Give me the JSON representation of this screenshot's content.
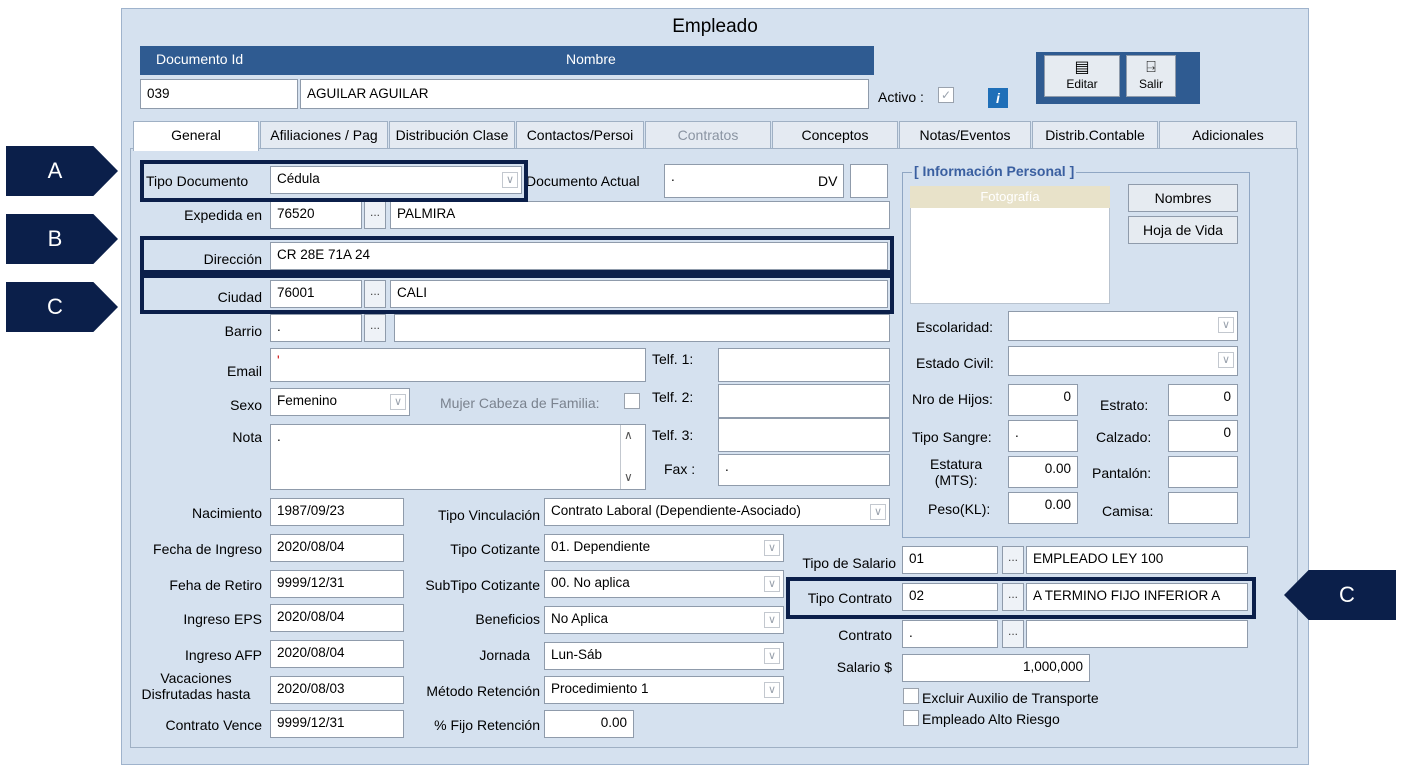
{
  "window": {
    "title": "Empleado"
  },
  "header": {
    "doc_id_label": "Documento Id",
    "name_label": "Nombre",
    "doc_id_value": "039",
    "name_value": "AGUILAR AGUILAR",
    "active_label": "Activo :",
    "info_icon": "i"
  },
  "toolbar": {
    "edit_label": "Editar",
    "exit_label": "Salir"
  },
  "tabs": [
    "General",
    "Afiliaciones / Pag",
    "Distribución Clase",
    "Contactos/Persoi",
    "Contratos",
    "Conceptos",
    "Notas/Eventos",
    "Distrib.Contable",
    "Adicionales"
  ],
  "form": {
    "tipo_documento_label": "Tipo Documento",
    "tipo_documento_value": "Cédula",
    "documento_actual_label": "Documento Actual",
    "documento_actual_value": ".",
    "dv_label": "DV",
    "dv_value": "",
    "expedida_label": "Expedida en",
    "expedida_code": "76520",
    "expedida_name": "PALMIRA",
    "direccion_label": "Dirección",
    "direccion_value": "CR 28E 71A 24",
    "ciudad_label": "Ciudad",
    "ciudad_code": "76001",
    "ciudad_name": "CALI",
    "barrio_label": "Barrio",
    "barrio_code": ".",
    "barrio_name": "",
    "email_label": "Email",
    "email_value": "'",
    "sexo_label": "Sexo",
    "sexo_value": "Femenino",
    "mujer_cabeza_label": "Mujer Cabeza de Familia:",
    "nota_label": "Nota",
    "nota_value": ".",
    "telf1_label": "Telf. 1:",
    "telf2_label": "Telf. 2:",
    "telf3_label": "Telf. 3:",
    "fax_label": "Fax :",
    "fax_value": ".",
    "nacimiento_label": "Nacimiento",
    "nacimiento_value": "1987/09/23",
    "fecha_ingreso_label": "Fecha de Ingreso",
    "fecha_ingreso_value": "2020/08/04",
    "fecha_retiro_label": "Feha de Retiro",
    "fecha_retiro_value": "9999/12/31",
    "ingreso_eps_label": "Ingreso EPS",
    "ingreso_eps_value": "2020/08/04",
    "ingreso_afp_label": "Ingreso AFP",
    "ingreso_afp_value": "2020/08/04",
    "vacaciones_label_1": "Vacaciones",
    "vacaciones_label_2": "Disfrutadas hasta",
    "vacaciones_value": "2020/08/03",
    "contrato_vence_label": "Contrato Vence",
    "contrato_vence_value": "9999/12/31",
    "tipo_vinculacion_label": "Tipo Vinculación",
    "tipo_vinculacion_value": "Contrato Laboral (Dependiente-Asociado)",
    "tipo_cotizante_label": "Tipo Cotizante",
    "tipo_cotizante_value": "01. Dependiente",
    "subtipo_cotizante_label": "SubTipo Cotizante",
    "subtipo_cotizante_value": "00. No aplica",
    "beneficios_label": "Beneficios",
    "beneficios_value": "No Aplica",
    "jornada_label": "Jornada",
    "jornada_value": "Lun-Sáb",
    "metodo_retencion_label": "Método Retención",
    "metodo_retencion_value": "Procedimiento 1",
    "fijo_retencion_label": "% Fijo Retención",
    "fijo_retencion_value": "0.00",
    "tipo_salario_label": "Tipo de Salario",
    "tipo_salario_code": "01",
    "tipo_salario_name": "EMPLEADO LEY 100",
    "tipo_contrato_label": "Tipo Contrato",
    "tipo_contrato_code": "02",
    "tipo_contrato_name": "A TERMINO FIJO  INFERIOR A",
    "contrato_label": "Contrato",
    "contrato_code": ".",
    "salario_label": "Salario $",
    "salario_value": "1,000,000",
    "excluir_auxilio_label": "Excluir Auxilio de Transporte",
    "alto_riesgo_label": "Empleado Alto Riesgo"
  },
  "personal": {
    "title": "[ Información Personal ]",
    "foto_label": "Fotografía",
    "nombres_button": "Nombres",
    "hoja_vida_button": "Hoja de Vida",
    "escolaridad_label": "Escolaridad:",
    "estado_civil_label": "Estado Civil:",
    "nro_hijos_label": "Nro de Hijos:",
    "nro_hijos_value": "0",
    "estrato_label": "Estrato:",
    "estrato_value": "0",
    "tipo_sangre_label": "Tipo Sangre:",
    "tipo_sangre_value": ".",
    "calzado_label": "Calzado:",
    "calzado_value": "0",
    "estatura_label_1": "Estatura",
    "estatura_label_2": "(MTS):",
    "estatura_value": "0.00",
    "pantalon_label": "Pantalón:",
    "peso_label": "Peso(KL):",
    "peso_value": "0.00",
    "camisa_label": "Camisa:"
  },
  "callouts": {
    "a": "A",
    "b": "B",
    "c": "C",
    "c2": "C"
  }
}
